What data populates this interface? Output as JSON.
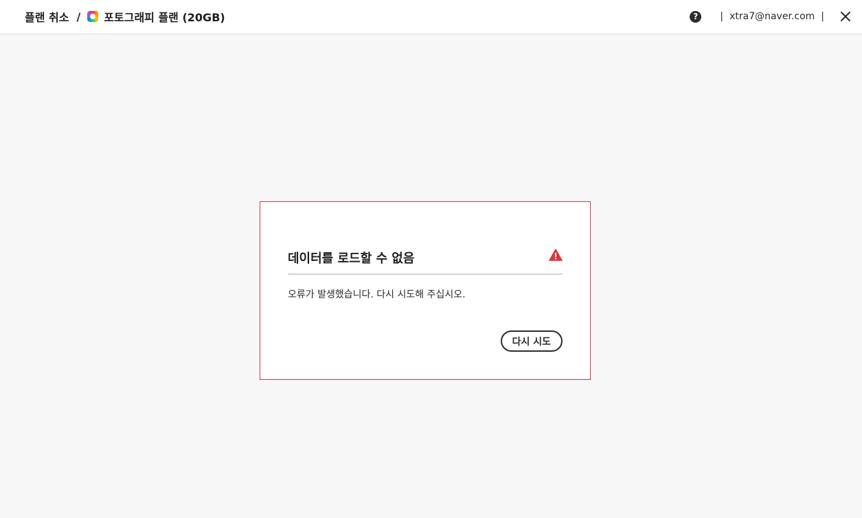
{
  "header": {
    "breadcrumb_parent": "플랜 취소",
    "breadcrumb_separator": "/",
    "plan_title": "포토그래피 플랜 (20GB)",
    "plan_icon": "creative-cloud-icon",
    "help_icon": "help-icon",
    "divider_left": "|",
    "user_email": "xtra7@naver.com",
    "divider_right": "|",
    "close_icon": "close-icon"
  },
  "dialog": {
    "title": "데이터를 로드할 수 없음",
    "alert_icon": "alert-icon",
    "message": "오류가 발생했습니다. 다시 시도해 주십시오.",
    "retry_label": "다시 시도"
  },
  "colors": {
    "error_border": "#d7373f",
    "alert_icon": "#d7373f",
    "page_background": "#f7f7f7"
  }
}
